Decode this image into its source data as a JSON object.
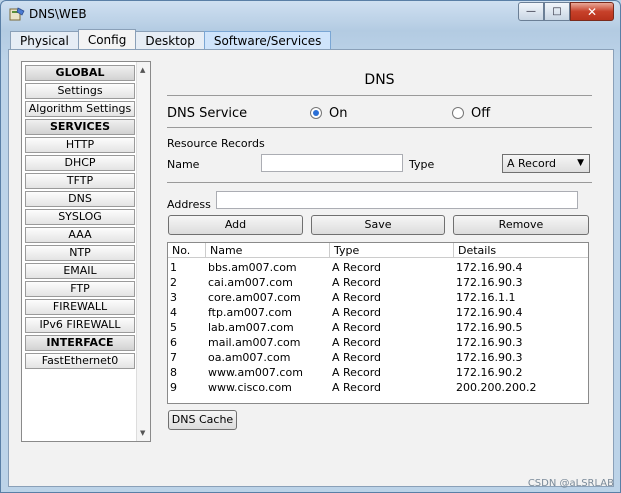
{
  "window": {
    "title": "DNS\\WEB",
    "minimize": "—",
    "maximize": "□",
    "close": "✕"
  },
  "tabs": [
    {
      "label": "Physical"
    },
    {
      "label": "Config"
    },
    {
      "label": "Desktop"
    },
    {
      "label": "Software/Services"
    }
  ],
  "sidebar": {
    "items": [
      {
        "label": "GLOBAL",
        "header": true
      },
      {
        "label": "Settings"
      },
      {
        "label": "Algorithm Settings"
      },
      {
        "label": "SERVICES",
        "header": true
      },
      {
        "label": "HTTP"
      },
      {
        "label": "DHCP"
      },
      {
        "label": "TFTP"
      },
      {
        "label": "DNS"
      },
      {
        "label": "SYSLOG"
      },
      {
        "label": "AAA"
      },
      {
        "label": "NTP"
      },
      {
        "label": "EMAIL"
      },
      {
        "label": "FTP"
      },
      {
        "label": "FIREWALL"
      },
      {
        "label": "IPv6 FIREWALL"
      },
      {
        "label": "INTERFACE",
        "header": true
      },
      {
        "label": "FastEthernet0"
      }
    ]
  },
  "dns": {
    "title": "DNS",
    "service_label": "DNS Service",
    "on_label": "On",
    "off_label": "Off",
    "service_state": "On",
    "resource_records_label": "Resource Records",
    "name_label": "Name",
    "name_value": "",
    "type_label": "Type",
    "type_value": "A Record",
    "address_label": "Address",
    "address_value": "",
    "add_label": "Add",
    "save_label": "Save",
    "remove_label": "Remove",
    "cache_label": "DNS Cache"
  },
  "table": {
    "headers": {
      "no": "No.",
      "name": "Name",
      "type": "Type",
      "details": "Details"
    },
    "rows": [
      {
        "no": "1",
        "name": "bbs.am007.com",
        "type": "A Record",
        "details": "172.16.90.4"
      },
      {
        "no": "2",
        "name": "cai.am007.com",
        "type": "A Record",
        "details": "172.16.90.3"
      },
      {
        "no": "3",
        "name": "core.am007.com",
        "type": "A Record",
        "details": "172.16.1.1"
      },
      {
        "no": "4",
        "name": "ftp.am007.com",
        "type": "A Record",
        "details": "172.16.90.4"
      },
      {
        "no": "5",
        "name": "lab.am007.com",
        "type": "A Record",
        "details": "172.16.90.5"
      },
      {
        "no": "6",
        "name": "mail.am007.com",
        "type": "A Record",
        "details": "172.16.90.3"
      },
      {
        "no": "7",
        "name": "oa.am007.com",
        "type": "A Record",
        "details": "172.16.90.3"
      },
      {
        "no": "8",
        "name": "www.am007.com",
        "type": "A Record",
        "details": "172.16.90.2"
      },
      {
        "no": "9",
        "name": "www.cisco.com",
        "type": "A Record",
        "details": "200.200.200.2"
      }
    ]
  },
  "watermark": "CSDN @aLSRLAB"
}
